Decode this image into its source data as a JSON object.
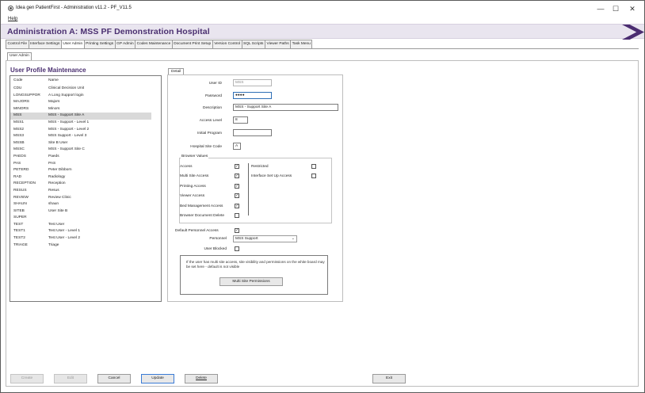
{
  "window": {
    "title": "Idea gen PatientFirst - Administration v11.2 - PF_V11.5",
    "minimize": "—",
    "maximize": "☐",
    "close": "✕"
  },
  "menu": {
    "help": "Help"
  },
  "header": {
    "title": "Administration A: MSS PF  Demonstration  Hospital",
    "accent": "#4b2d71"
  },
  "tabs": [
    "Control File",
    "Interface Settings",
    "User Admin",
    "Printing Settings",
    "GP Admin",
    "Codes Maintenance",
    "Document Print Setup",
    "Version Control",
    "SQL Scripts",
    "Viewer Paths",
    "Task Menu"
  ],
  "active_tab": "User Admin",
  "subtabs": [
    "User Admin"
  ],
  "section_title": "User Profile Maintenance",
  "list": {
    "headers": {
      "code": "Code",
      "name": "Name"
    },
    "rows": [
      {
        "code": "CDU",
        "name": "Clinical Decision Unit"
      },
      {
        "code": "LONGSUPPOR",
        "name": "A Long Support login"
      },
      {
        "code": "MAJORS",
        "name": "Majors"
      },
      {
        "code": "MINORS",
        "name": "Minors"
      },
      {
        "code": "MSS",
        "name": "MSS - Support Site A"
      },
      {
        "code": "MSS1",
        "name": "MSS - Support - Level 1"
      },
      {
        "code": "MSS2",
        "name": "MSS - Support - Level 2"
      },
      {
        "code": "MSS3",
        "name": "MSS Support - Level 3"
      },
      {
        "code": "MSSB",
        "name": "Site B User"
      },
      {
        "code": "MSSC",
        "name": "MSS - Support Site C"
      },
      {
        "code": "PAEDS",
        "name": "Paeds"
      },
      {
        "code": "PAS",
        "name": "PAS"
      },
      {
        "code": "PETERD",
        "name": "Peter Dibborn"
      },
      {
        "code": "RAD",
        "name": "Radiology"
      },
      {
        "code": "RECEPTION",
        "name": "Reception"
      },
      {
        "code": "RESUS",
        "name": "Resus"
      },
      {
        "code": "REVIEW",
        "name": "Review Clinic"
      },
      {
        "code": "SHAUN",
        "name": "shaun"
      },
      {
        "code": "SITEB",
        "name": "User Site B"
      },
      {
        "code": "SUPER",
        "name": ""
      },
      {
        "code": "TEST",
        "name": "Test User"
      },
      {
        "code": "TEST1",
        "name": "Test User - Level 1"
      },
      {
        "code": "TEST2",
        "name": "Test User - Level 2"
      },
      {
        "code": "TRIAGE",
        "name": "Triage"
      }
    ],
    "selected": "MSS"
  },
  "detail": {
    "tab": "Detail",
    "user_id_label": "User ID",
    "user_id": "MSS",
    "password_label": "Password",
    "password": "●●●●",
    "description_label": "Description",
    "description": "MSS - Support Site A",
    "access_level_label": "Access Level",
    "access_level": "8",
    "initial_program_label": "Initial Program",
    "initial_program": "",
    "hospital_site_label": "Hospital Site Code",
    "hospital_site": "A",
    "browser_values_label": "Browser Values",
    "checks_left": [
      {
        "label": "Access",
        "checked": true
      },
      {
        "label": "Multi Site Access",
        "checked": true
      },
      {
        "label": "Printing Access",
        "checked": true
      },
      {
        "label": "Viewer Access",
        "checked": true
      },
      {
        "label": "Bed Management Access",
        "checked": true
      },
      {
        "label": "Browser Document Delete",
        "checked": false
      }
    ],
    "checks_right": [
      {
        "label": "Restricted",
        "checked": false
      },
      {
        "label": "Interface Set Up Access",
        "checked": false
      }
    ],
    "default_personnel_label": "Default Personnel Access",
    "default_personnel_checked": true,
    "personnel_label": "Personnel",
    "personnel_value": "MSS Support",
    "user_blocked_label": "User Blocked",
    "user_blocked_checked": false,
    "info_text": "If the user has multi site access, site visibility and permissions on the white board may be set here - default is not visible",
    "multi_site_button": "Multi Site Permissions"
  },
  "buttons": {
    "create": "Create",
    "edit": "Edit",
    "cancel": "Cancel",
    "update": "Update",
    "delete": "Delete",
    "exit": "Exit"
  }
}
